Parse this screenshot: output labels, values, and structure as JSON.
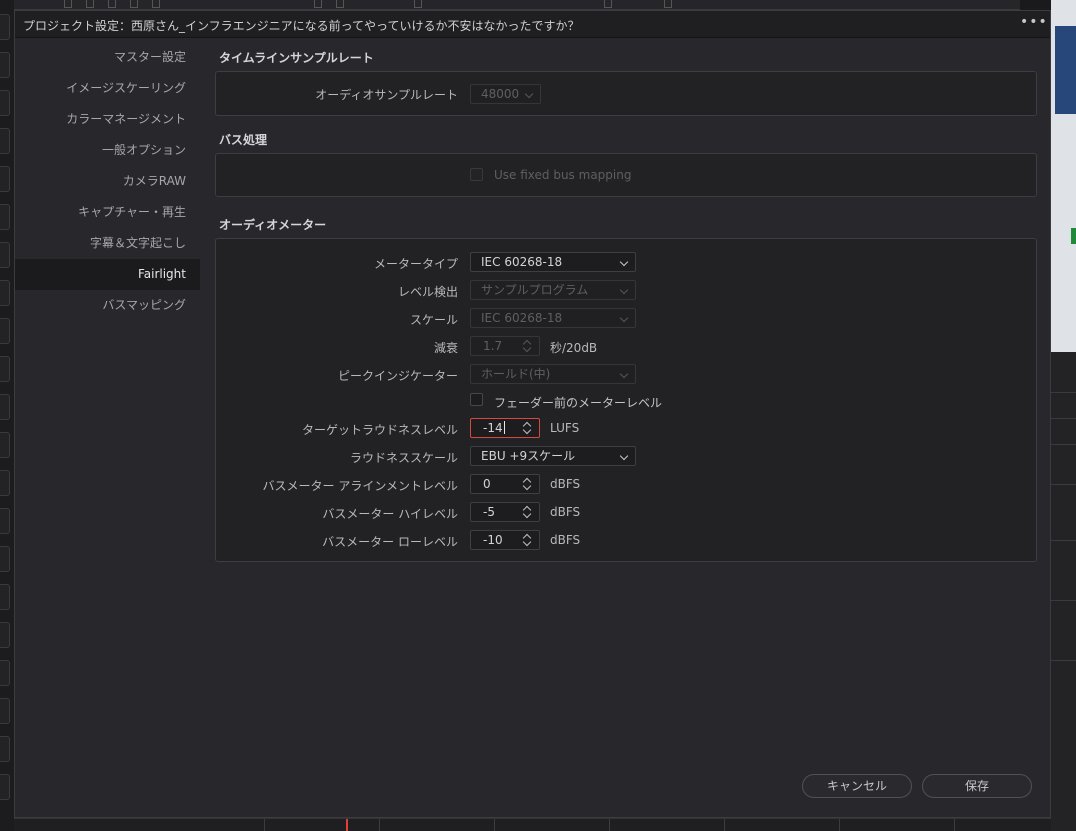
{
  "window": {
    "title": "プロジェクト設定：西原さん_インフラエンジニアになる前ってやっていけるか不安はなかったですか？",
    "more_label": "•••"
  },
  "sidebar": {
    "items": [
      {
        "label": "マスター設定",
        "active": false
      },
      {
        "label": "イメージスケーリング",
        "active": false
      },
      {
        "label": "カラーマネージメント",
        "active": false
      },
      {
        "label": "一般オプション",
        "active": false
      },
      {
        "label": "カメラRAW",
        "active": false
      },
      {
        "label": "キャプチャー・再生",
        "active": false
      },
      {
        "label": "字幕＆文字起こし",
        "active": false
      },
      {
        "label": "Fairlight",
        "active": true
      },
      {
        "label": "バスマッピング",
        "active": false
      }
    ]
  },
  "timeline_sample_rate": {
    "section_title": "タイムラインサンプルレート",
    "audio_sample_rate_label": "オーディオサンプルレート",
    "audio_sample_rate_value": "48000"
  },
  "bus_processing": {
    "section_title": "バス処理",
    "fixed_bus_mapping_label": "Use fixed bus mapping",
    "fixed_bus_mapping_checked": false
  },
  "audio_meter": {
    "section_title": "オーディオメーター",
    "meter_type_label": "メータータイプ",
    "meter_type_value": "IEC 60268-18",
    "level_detection_label": "レベル検出",
    "level_detection_value": "サンプルプログラム",
    "scale_label": "スケール",
    "scale_value": "IEC 60268-18",
    "decay_label": "減衰",
    "decay_value": "1.7",
    "decay_unit": "秒/20dB",
    "peak_indicator_label": "ピークインジケーター",
    "peak_indicator_value": "ホールド(中)",
    "pre_fader_label": "フェーダー前のメーターレベル",
    "pre_fader_checked": false,
    "target_loudness_label": "ターゲットラウドネスレベル",
    "target_loudness_value": "-14",
    "target_loudness_unit": "LUFS",
    "loudness_scale_label": "ラウドネススケール",
    "loudness_scale_value": "EBU +9スケール",
    "bus_align_label": "バスメーター アラインメントレベル",
    "bus_align_value": "0",
    "bus_align_unit": "dBFS",
    "bus_high_label": "バスメーター ハイレベル",
    "bus_high_value": "-5",
    "bus_high_unit": "dBFS",
    "bus_low_label": "バスメーター ローレベル",
    "bus_low_value": "-10",
    "bus_low_unit": "dBFS"
  },
  "footer": {
    "cancel_label": "キャンセル",
    "save_label": "保存"
  },
  "colors": {
    "focus_border": "#d54a3f",
    "playhead": "#e0403a"
  }
}
